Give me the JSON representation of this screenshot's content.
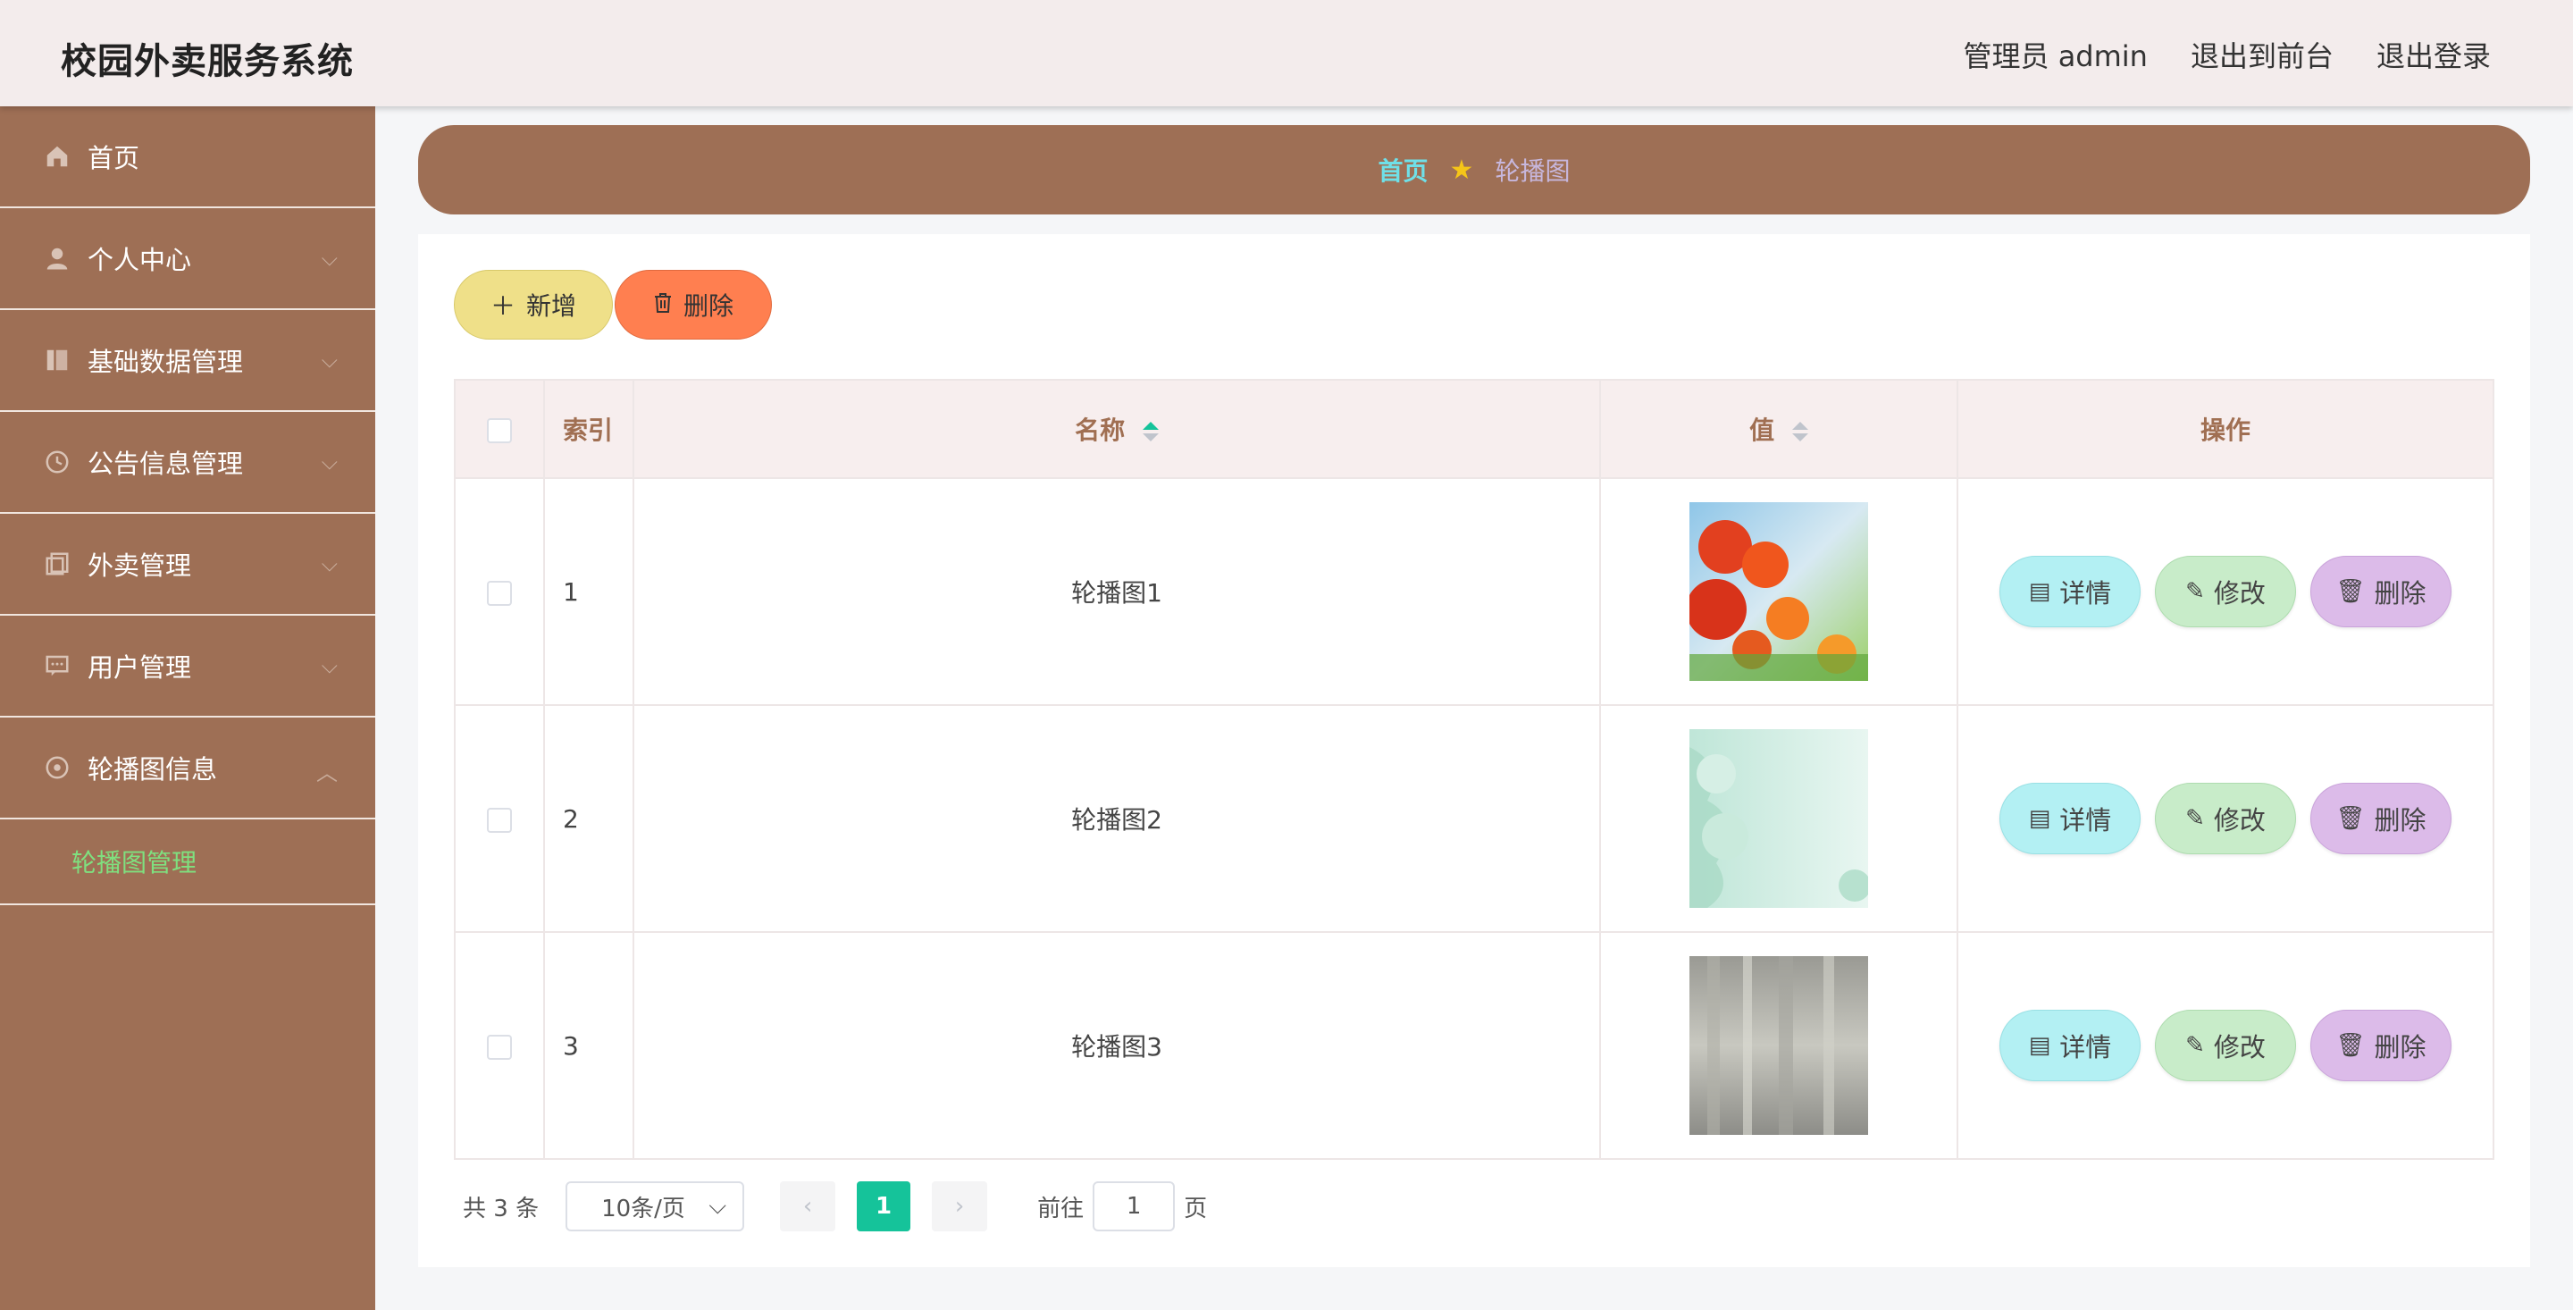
{
  "app": {
    "title": "校园外卖服务系统"
  },
  "topnav": {
    "admin": "管理员 admin",
    "front": "退出到前台",
    "logout": "退出登录"
  },
  "sidebar": {
    "items": [
      {
        "label": "首页",
        "icon": "home-icon"
      },
      {
        "label": "个人中心",
        "icon": "user-icon"
      },
      {
        "label": "基础数据管理",
        "icon": "book-icon"
      },
      {
        "label": "公告信息管理",
        "icon": "clock-icon"
      },
      {
        "label": "外卖管理",
        "icon": "copy-icon"
      },
      {
        "label": "用户管理",
        "icon": "chat-icon"
      },
      {
        "label": "轮播图信息",
        "icon": "disc-icon"
      }
    ],
    "sub_active": "轮播图管理"
  },
  "breadcrumb": {
    "home": "首页",
    "current": "轮播图",
    "star_color": "#f5c518"
  },
  "toolbar": {
    "add_label": "新增",
    "delete_label": "删除"
  },
  "table": {
    "columns": {
      "index": "索引",
      "name": "名称",
      "value": "值",
      "action": "操作"
    },
    "rows": [
      {
        "index": "1",
        "name": "轮播图1",
        "image": "flowers"
      },
      {
        "index": "2",
        "name": "轮播图2",
        "image": "mint-petals"
      },
      {
        "index": "3",
        "name": "轮播图3",
        "image": "gray-blur"
      }
    ],
    "actions": {
      "detail": "详情",
      "edit": "修改",
      "delete": "删除"
    }
  },
  "pagination": {
    "total_text": "共 3 条",
    "page_size": "10条/页",
    "current_page": "1",
    "goto_prefix": "前往",
    "goto_value": "1",
    "goto_suffix": "页"
  },
  "colors": {
    "sidebar": "#9e6f55",
    "accent": "#15c39a",
    "submenu_active": "#7fe07f"
  }
}
